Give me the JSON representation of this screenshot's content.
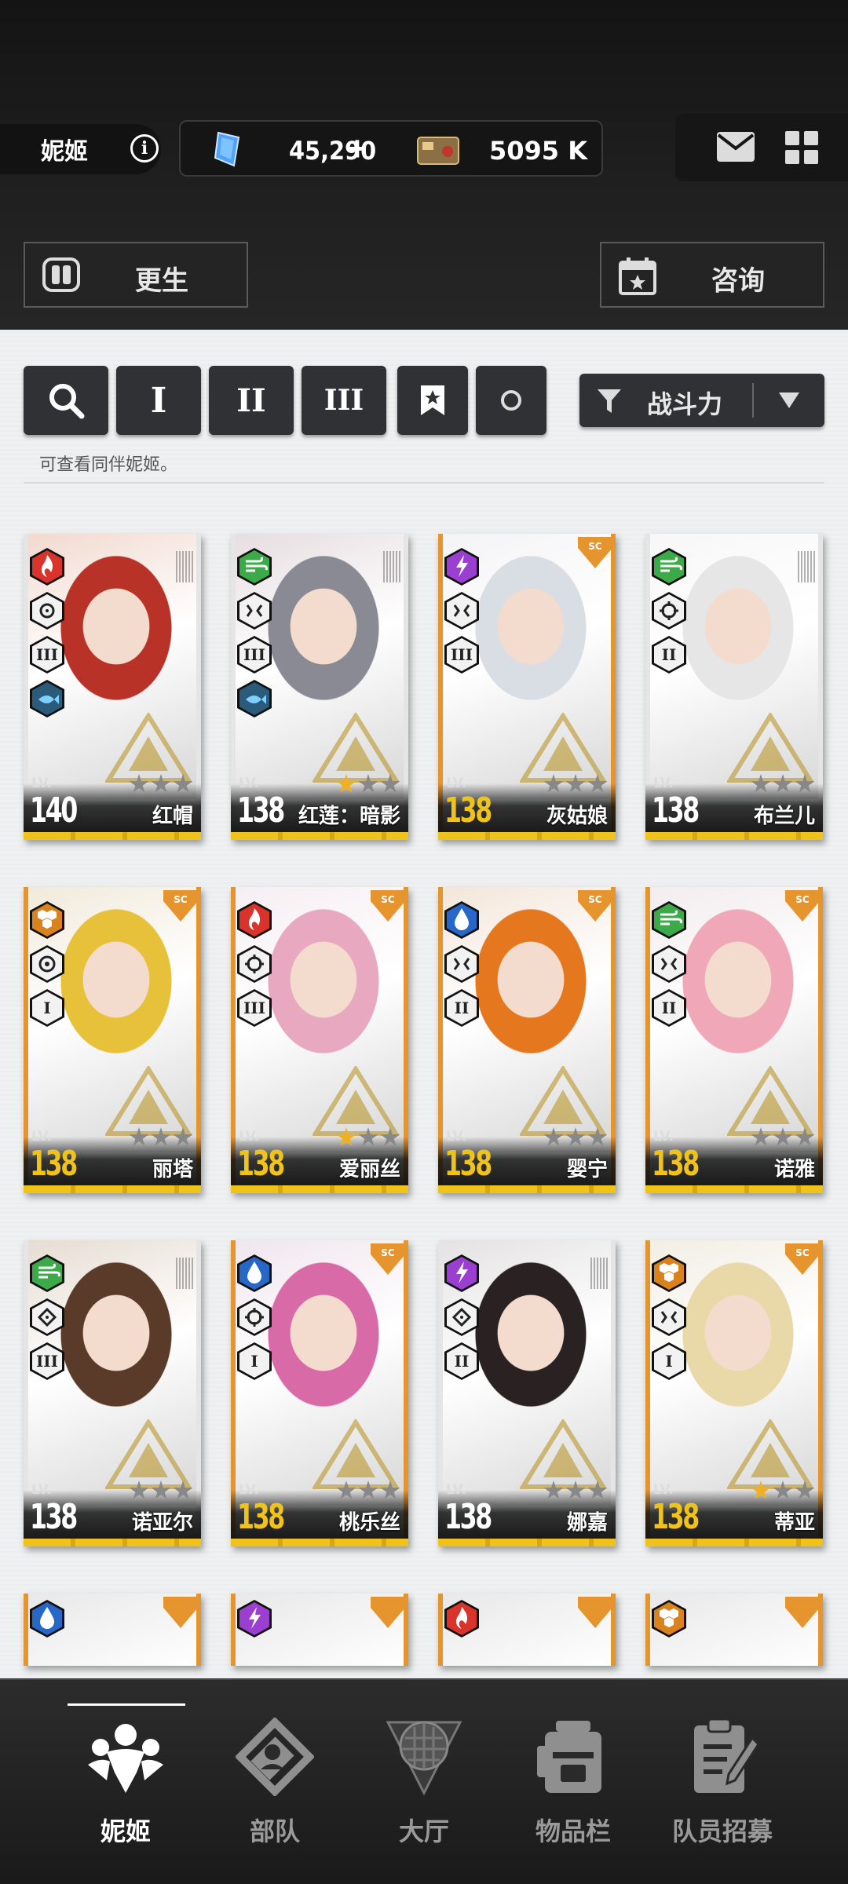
{
  "header": {
    "screen_title": "妮姬",
    "gems": "45,290",
    "gems_plus": "+",
    "credits": "5095 K"
  },
  "actions": {
    "rebirth": "更生",
    "consult": "咨询"
  },
  "filters": {
    "class_1": "I",
    "class_2": "II",
    "class_3": "III",
    "sort_label": "战斗力",
    "hint": "可查看同伴妮姬。"
  },
  "colors": {
    "fire": "#d9332b",
    "wind": "#3daa4a",
    "electric": "#9a3fcf",
    "water": "#2667c8",
    "iron": "#d9821e",
    "gold_strip": "#f0c31a",
    "orange_frame": "#e6942e"
  },
  "cards": [
    {
      "level": "LV.",
      "lv": "140",
      "name": "红帽",
      "element": "fire",
      "weapon": "crosshair",
      "burst": "III",
      "extra": "water-fish",
      "stars": 0,
      "frame": "gold",
      "lvcolor": "#ffffff"
    },
    {
      "level": "LV.",
      "lv": "138",
      "name": "红莲：暗影",
      "element": "wind",
      "weapon": "bracket",
      "burst": "III",
      "extra": "water-fish",
      "stars": 1,
      "frame": "gold",
      "lvcolor": "#ffffff"
    },
    {
      "level": "LV.",
      "lv": "138",
      "name": "灰姑娘",
      "element": "electric",
      "weapon": "bracket",
      "burst": "III",
      "extra": "",
      "stars": 0,
      "frame": "orange",
      "lvcolor": "#f0c31a"
    },
    {
      "level": "LV.",
      "lv": "138",
      "name": "布兰儿",
      "element": "wind",
      "weapon": "target",
      "burst": "II",
      "extra": "",
      "stars": 0,
      "frame": "gold",
      "lvcolor": "#ffffff"
    },
    {
      "level": "LV.",
      "lv": "138",
      "name": "丽塔",
      "element": "iron",
      "weapon": "circle",
      "burst": "I",
      "extra": "",
      "stars": 0,
      "frame": "orange",
      "lvcolor": "#f0c31a"
    },
    {
      "level": "LV.",
      "lv": "138",
      "name": "爱丽丝",
      "element": "fire",
      "weapon": "target",
      "burst": "III",
      "extra": "",
      "stars": 1,
      "frame": "orange",
      "lvcolor": "#f0c31a"
    },
    {
      "level": "LV.",
      "lv": "138",
      "name": "婴宁",
      "element": "water",
      "weapon": "bracket",
      "burst": "II",
      "extra": "",
      "stars": 0,
      "frame": "orange",
      "lvcolor": "#f0c31a"
    },
    {
      "level": "LV.",
      "lv": "138",
      "name": "诺雅",
      "element": "wind",
      "weapon": "bracket",
      "burst": "II",
      "extra": "",
      "stars": 0,
      "frame": "orange",
      "lvcolor": "#f0c31a"
    },
    {
      "level": "LV.",
      "lv": "138",
      "name": "诺亚尔",
      "element": "wind",
      "weapon": "diamond",
      "burst": "III",
      "extra": "",
      "stars": 0,
      "frame": "gold",
      "lvcolor": "#ffffff"
    },
    {
      "level": "LV.",
      "lv": "138",
      "name": "桃乐丝",
      "element": "water",
      "weapon": "target",
      "burst": "I",
      "extra": "",
      "stars": 0,
      "frame": "orange",
      "lvcolor": "#f0c31a"
    },
    {
      "level": "LV.",
      "lv": "138",
      "name": "娜嘉",
      "element": "electric",
      "weapon": "diamond",
      "burst": "II",
      "extra": "",
      "stars": 0,
      "frame": "gold",
      "lvcolor": "#ffffff"
    },
    {
      "level": "LV.",
      "lv": "138",
      "name": "蒂亚",
      "element": "iron",
      "weapon": "bracket",
      "burst": "I",
      "extra": "",
      "stars": 1,
      "frame": "orange",
      "lvcolor": "#f0c31a"
    }
  ],
  "partial_cards": [
    {
      "element": "water"
    },
    {
      "element": "electric"
    },
    {
      "element": "fire"
    },
    {
      "element": "iron"
    }
  ],
  "nav": {
    "nikke": "妮姬",
    "squad": "部队",
    "lobby": "大厅",
    "inventory": "物品栏",
    "recruit": "队员招募"
  }
}
